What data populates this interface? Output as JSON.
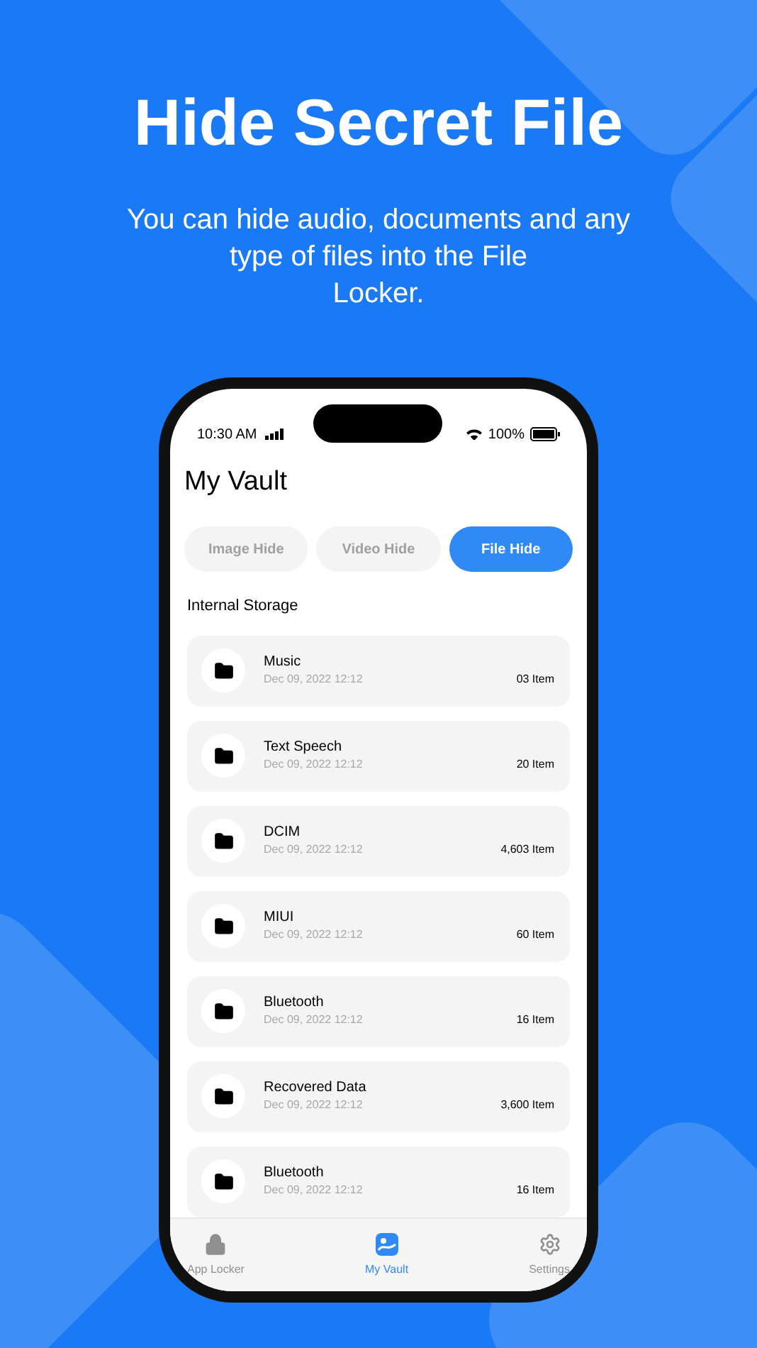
{
  "headline": "Hide Secret File",
  "subtitle_lines": [
    "You can hide audio, documents and any",
    "type of files into the File",
    "Locker."
  ],
  "status_bar": {
    "time": "10:30 AM",
    "battery": "100%"
  },
  "title": "My Vault",
  "tabs": [
    {
      "label": "Image Hide",
      "selected": false
    },
    {
      "label": "Video Hide",
      "selected": false
    },
    {
      "label": "File Hide",
      "selected": true
    }
  ],
  "section": "Internal Storage",
  "folders": [
    {
      "name": "Music",
      "date": "Dec 09, 2022 12:12",
      "count": "03 Item"
    },
    {
      "name": "Text Speech",
      "date": "Dec 09, 2022 12:12",
      "count": "20 Item"
    },
    {
      "name": "DCIM",
      "date": "Dec 09, 2022 12:12",
      "count": "4,603 Item"
    },
    {
      "name": "MIUI",
      "date": "Dec 09, 2022 12:12",
      "count": "60 Item"
    },
    {
      "name": "Bluetooth",
      "date": "Dec 09, 2022 12:12",
      "count": "16 Item"
    },
    {
      "name": "Recovered Data",
      "date": "Dec 09, 2022 12:12",
      "count": "3,600 Item"
    },
    {
      "name": "Bluetooth",
      "date": "Dec 09, 2022 12:12",
      "count": "16 Item"
    }
  ],
  "nav": [
    {
      "kind": "lock",
      "label": "App Locker",
      "selected": false
    },
    {
      "kind": "vault",
      "label": "My Vault",
      "selected": true
    },
    {
      "kind": "gear",
      "label": "Settings",
      "selected": false
    }
  ]
}
